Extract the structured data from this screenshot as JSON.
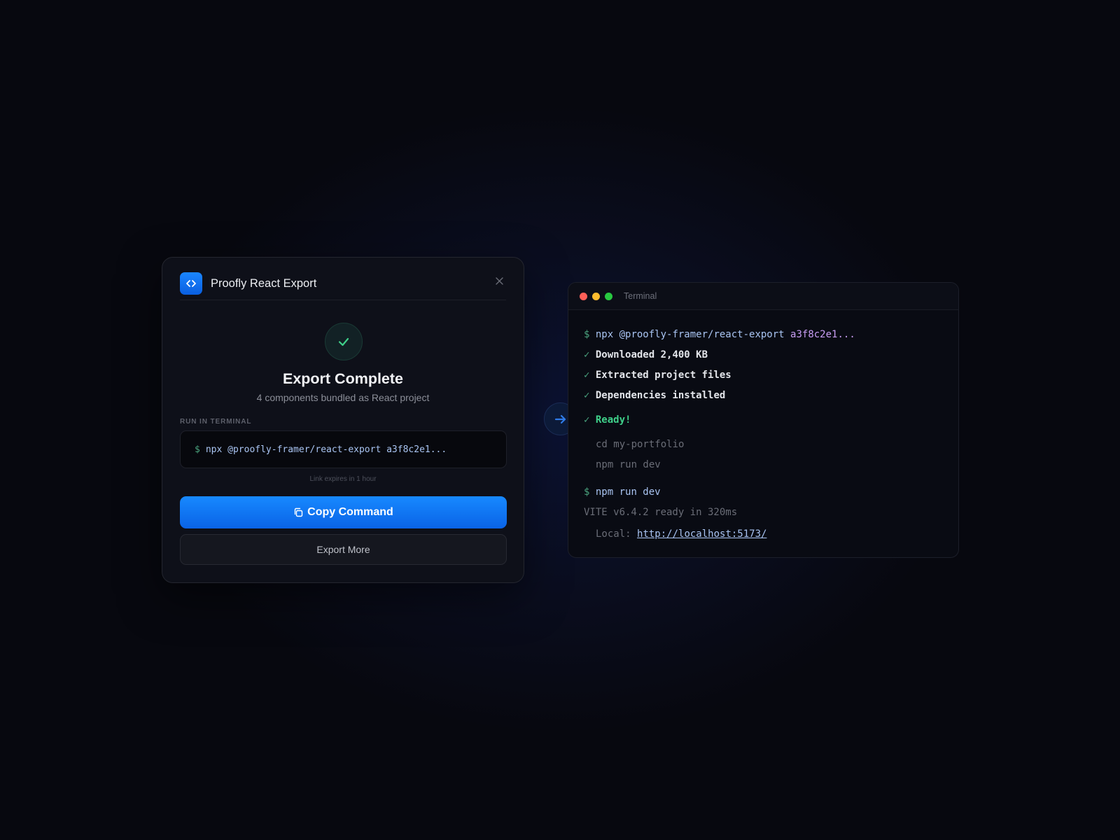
{
  "modal": {
    "title": "Proofly React Export",
    "heading": "Export Complete",
    "subheading": "4 components bundled as React project",
    "section_label": "RUN IN TERMINAL",
    "command_prompt": "$",
    "command": "npx @proofly-framer/react-export a3f8c2e1...",
    "expires_note": "Link expires in 1 hour",
    "primary_button": "Copy Command",
    "secondary_button": "Export More"
  },
  "terminal": {
    "title": "Terminal",
    "prompt": "$",
    "line1_cmd": "npx @proofly-framer/react-export",
    "line1_hash": "a3f8c2e1...",
    "check": "✓",
    "downloaded": "Downloaded 2,400 KB",
    "extracted": "Extracted project files",
    "dependencies": "Dependencies installed",
    "ready": "Ready!",
    "hint1": "cd my-portfolio",
    "hint2": "npm run dev",
    "run_cmd": "npm run dev",
    "vite_status": "VITE v6.4.2 ready in 320ms",
    "local_label": "Local:",
    "local_url": "http://localhost:5173/"
  },
  "colors": {
    "accent_blue": "#1789ff",
    "success_green": "#3fd08a",
    "hash_purple": "#c99ef5"
  },
  "icons": [
    "code-icon",
    "close-icon",
    "check-icon",
    "copy-icon",
    "arrow-right-icon"
  ]
}
